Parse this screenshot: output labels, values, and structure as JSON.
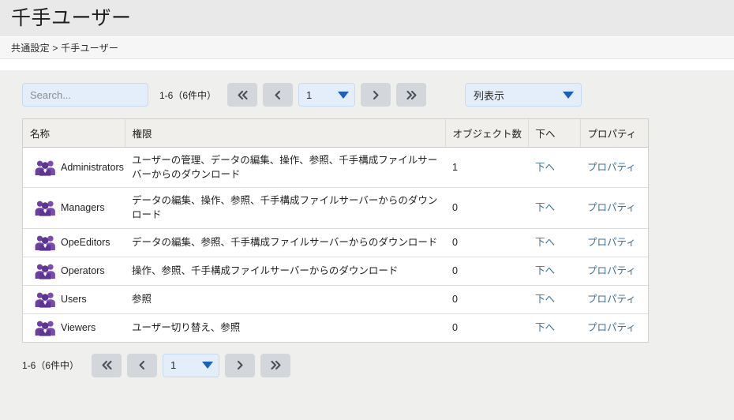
{
  "header": {
    "title": "千手ユーザー",
    "breadcrumb": "共通設定 > 千手ユーザー"
  },
  "toolbar": {
    "search_placeholder": "Search...",
    "search_value": "",
    "range_text": "1-6（6件中）",
    "first_page_icon": "double-chevron-left-icon",
    "prev_page_icon": "chevron-left-icon",
    "next_page_icon": "chevron-right-icon",
    "last_page_icon": "double-chevron-right-icon",
    "page_value": "1",
    "column_display_label": "列表示"
  },
  "table": {
    "columns": [
      {
        "key": "name",
        "label": "名称"
      },
      {
        "key": "perm",
        "label": "権限"
      },
      {
        "key": "count",
        "label": "オブジェクト数"
      },
      {
        "key": "down",
        "label": "下へ"
      },
      {
        "key": "prop",
        "label": "プロパティ"
      }
    ],
    "rows": [
      {
        "icon": "user-group-icon",
        "name": "Administrators",
        "perm": "ユーザーの管理、データの編集、操作、参照、千手構成ファイルサーバーからのダウンロード",
        "count": "1",
        "down": "下へ",
        "prop": "プロパティ"
      },
      {
        "icon": "user-group-icon",
        "name": "Managers",
        "perm": "データの編集、操作、参照、千手構成ファイルサーバーからのダウンロード",
        "count": "0",
        "down": "下へ",
        "prop": "プロパティ"
      },
      {
        "icon": "user-group-icon",
        "name": "OpeEditors",
        "perm": "データの編集、参照、千手構成ファイルサーバーからのダウンロード",
        "count": "0",
        "down": "下へ",
        "prop": "プロパティ"
      },
      {
        "icon": "user-group-icon",
        "name": "Operators",
        "perm": "操作、参照、千手構成ファイルサーバーからのダウンロード",
        "count": "0",
        "down": "下へ",
        "prop": "プロパティ"
      },
      {
        "icon": "user-group-icon",
        "name": "Users",
        "perm": "参照",
        "count": "0",
        "down": "下へ",
        "prop": "プロパティ"
      },
      {
        "icon": "user-group-icon",
        "name": "Viewers",
        "perm": "ユーザー切り替え、参照",
        "count": "0",
        "down": "下へ",
        "prop": "プロパティ"
      }
    ]
  },
  "bottom_pager": {
    "range_text": "1-6（6件中）",
    "first_page_icon": "double-chevron-left-icon",
    "prev_page_icon": "chevron-left-icon",
    "next_page_icon": "chevron-right-icon",
    "last_page_icon": "double-chevron-right-icon",
    "page_value": "1"
  },
  "colors": {
    "icon_purple": "#6c3fa0",
    "link_blue": "#3d6e8f",
    "select_blue": "#e4eefb",
    "arrow_blue": "#1a5fc4",
    "button_grey": "#d3d6db",
    "panel_bg": "#eff0ee",
    "table_header_bg": "#f0efeb"
  }
}
